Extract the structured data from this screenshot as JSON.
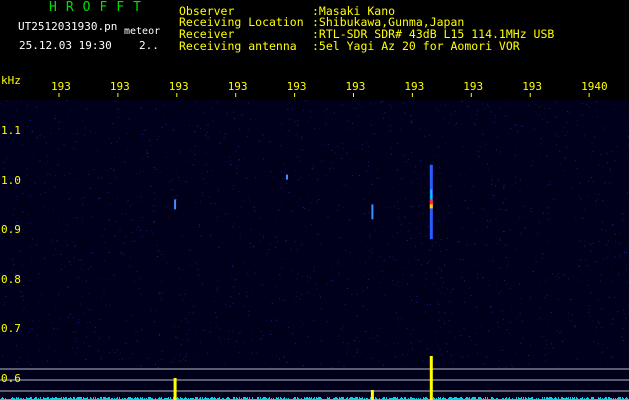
{
  "header": {
    "app_title": "HROFFT",
    "file_name": "UT2512031930.pn",
    "mode_label": "meteor",
    "date_time": "25.12.03 19:30",
    "counter": "2..",
    "title_color": "#00e000",
    "info_text_color": "#ffff00"
  },
  "info": [
    {
      "label": "Observer",
      "value": ":Masaki Kano"
    },
    {
      "label": "Receiving Location",
      "value": ":Shibukawa,Gunma,Japan"
    },
    {
      "label": "Receiver",
      "value": ":RTL-SDR SDR# 43dB L15 114.1MHz USB"
    },
    {
      "label": "Receiving antenna",
      "value": ":5el Yagi Az 20 for Aomori VOR"
    }
  ],
  "axes": {
    "y_unit": "kHz",
    "y_ticks": [
      "1.1",
      "1.0",
      "0.9",
      "0.8",
      "0.7",
      "0.6"
    ],
    "x_ticks": [
      "193",
      "193",
      "193",
      "193",
      "193",
      "193",
      "193",
      "193",
      "193",
      "1940"
    ],
    "x_range_minutes": [
      1930,
      1940
    ],
    "y_range_khz": [
      0.58,
      1.17
    ]
  },
  "chart_data": {
    "type": "heatmap",
    "background_color": "#00001a",
    "noise_color": "#1a2a8a",
    "echoes": [
      {
        "time": 1937.0,
        "freq_khz_low": 0.88,
        "freq_khz_high": 1.03,
        "strength": "strong"
      },
      {
        "time": 1932.65,
        "freq_khz_low": 0.94,
        "freq_khz_high": 0.96,
        "strength": "weak"
      },
      {
        "time": 1934.55,
        "freq_khz_low": 1.0,
        "freq_khz_high": 1.01,
        "strength": "weak"
      },
      {
        "time": 1936.0,
        "freq_khz_low": 0.92,
        "freq_khz_high": 0.95,
        "strength": "weak"
      }
    ],
    "spectrum_peaks": [
      {
        "time": 1937.0,
        "level": "high"
      },
      {
        "time": 1932.65,
        "level": "medium"
      },
      {
        "time": 1936.0,
        "level": "low"
      }
    ]
  }
}
